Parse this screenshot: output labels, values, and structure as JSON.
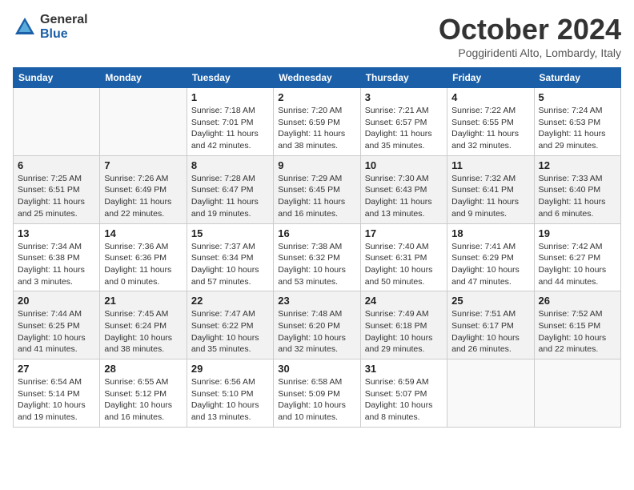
{
  "header": {
    "logo_general": "General",
    "logo_blue": "Blue",
    "title": "October 2024",
    "location": "Poggiridenti Alto, Lombardy, Italy"
  },
  "days_of_week": [
    "Sunday",
    "Monday",
    "Tuesday",
    "Wednesday",
    "Thursday",
    "Friday",
    "Saturday"
  ],
  "weeks": [
    [
      {
        "day": "",
        "info": ""
      },
      {
        "day": "",
        "info": ""
      },
      {
        "day": "1",
        "info": "Sunrise: 7:18 AM\nSunset: 7:01 PM\nDaylight: 11 hours and 42 minutes."
      },
      {
        "day": "2",
        "info": "Sunrise: 7:20 AM\nSunset: 6:59 PM\nDaylight: 11 hours and 38 minutes."
      },
      {
        "day": "3",
        "info": "Sunrise: 7:21 AM\nSunset: 6:57 PM\nDaylight: 11 hours and 35 minutes."
      },
      {
        "day": "4",
        "info": "Sunrise: 7:22 AM\nSunset: 6:55 PM\nDaylight: 11 hours and 32 minutes."
      },
      {
        "day": "5",
        "info": "Sunrise: 7:24 AM\nSunset: 6:53 PM\nDaylight: 11 hours and 29 minutes."
      }
    ],
    [
      {
        "day": "6",
        "info": "Sunrise: 7:25 AM\nSunset: 6:51 PM\nDaylight: 11 hours and 25 minutes."
      },
      {
        "day": "7",
        "info": "Sunrise: 7:26 AM\nSunset: 6:49 PM\nDaylight: 11 hours and 22 minutes."
      },
      {
        "day": "8",
        "info": "Sunrise: 7:28 AM\nSunset: 6:47 PM\nDaylight: 11 hours and 19 minutes."
      },
      {
        "day": "9",
        "info": "Sunrise: 7:29 AM\nSunset: 6:45 PM\nDaylight: 11 hours and 16 minutes."
      },
      {
        "day": "10",
        "info": "Sunrise: 7:30 AM\nSunset: 6:43 PM\nDaylight: 11 hours and 13 minutes."
      },
      {
        "day": "11",
        "info": "Sunrise: 7:32 AM\nSunset: 6:41 PM\nDaylight: 11 hours and 9 minutes."
      },
      {
        "day": "12",
        "info": "Sunrise: 7:33 AM\nSunset: 6:40 PM\nDaylight: 11 hours and 6 minutes."
      }
    ],
    [
      {
        "day": "13",
        "info": "Sunrise: 7:34 AM\nSunset: 6:38 PM\nDaylight: 11 hours and 3 minutes."
      },
      {
        "day": "14",
        "info": "Sunrise: 7:36 AM\nSunset: 6:36 PM\nDaylight: 11 hours and 0 minutes."
      },
      {
        "day": "15",
        "info": "Sunrise: 7:37 AM\nSunset: 6:34 PM\nDaylight: 10 hours and 57 minutes."
      },
      {
        "day": "16",
        "info": "Sunrise: 7:38 AM\nSunset: 6:32 PM\nDaylight: 10 hours and 53 minutes."
      },
      {
        "day": "17",
        "info": "Sunrise: 7:40 AM\nSunset: 6:31 PM\nDaylight: 10 hours and 50 minutes."
      },
      {
        "day": "18",
        "info": "Sunrise: 7:41 AM\nSunset: 6:29 PM\nDaylight: 10 hours and 47 minutes."
      },
      {
        "day": "19",
        "info": "Sunrise: 7:42 AM\nSunset: 6:27 PM\nDaylight: 10 hours and 44 minutes."
      }
    ],
    [
      {
        "day": "20",
        "info": "Sunrise: 7:44 AM\nSunset: 6:25 PM\nDaylight: 10 hours and 41 minutes."
      },
      {
        "day": "21",
        "info": "Sunrise: 7:45 AM\nSunset: 6:24 PM\nDaylight: 10 hours and 38 minutes."
      },
      {
        "day": "22",
        "info": "Sunrise: 7:47 AM\nSunset: 6:22 PM\nDaylight: 10 hours and 35 minutes."
      },
      {
        "day": "23",
        "info": "Sunrise: 7:48 AM\nSunset: 6:20 PM\nDaylight: 10 hours and 32 minutes."
      },
      {
        "day": "24",
        "info": "Sunrise: 7:49 AM\nSunset: 6:18 PM\nDaylight: 10 hours and 29 minutes."
      },
      {
        "day": "25",
        "info": "Sunrise: 7:51 AM\nSunset: 6:17 PM\nDaylight: 10 hours and 26 minutes."
      },
      {
        "day": "26",
        "info": "Sunrise: 7:52 AM\nSunset: 6:15 PM\nDaylight: 10 hours and 22 minutes."
      }
    ],
    [
      {
        "day": "27",
        "info": "Sunrise: 6:54 AM\nSunset: 5:14 PM\nDaylight: 10 hours and 19 minutes."
      },
      {
        "day": "28",
        "info": "Sunrise: 6:55 AM\nSunset: 5:12 PM\nDaylight: 10 hours and 16 minutes."
      },
      {
        "day": "29",
        "info": "Sunrise: 6:56 AM\nSunset: 5:10 PM\nDaylight: 10 hours and 13 minutes."
      },
      {
        "day": "30",
        "info": "Sunrise: 6:58 AM\nSunset: 5:09 PM\nDaylight: 10 hours and 10 minutes."
      },
      {
        "day": "31",
        "info": "Sunrise: 6:59 AM\nSunset: 5:07 PM\nDaylight: 10 hours and 8 minutes."
      },
      {
        "day": "",
        "info": ""
      },
      {
        "day": "",
        "info": ""
      }
    ]
  ]
}
